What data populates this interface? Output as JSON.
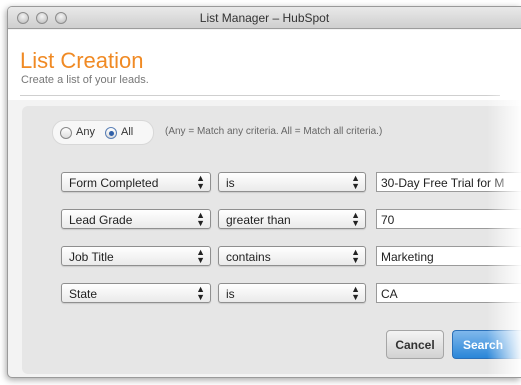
{
  "window": {
    "title": "List Manager – HubSpot"
  },
  "page": {
    "title": "List Creation",
    "subtitle": "Create a list of your leads."
  },
  "match": {
    "any_label": "Any",
    "all_label": "All",
    "selected": "All",
    "help": "(Any = Match any criteria. All = Match all criteria.)"
  },
  "criteria": [
    {
      "field": "Form Completed",
      "operator": "is",
      "value": "30-Day Free Trial for M"
    },
    {
      "field": "Lead Grade",
      "operator": "greater than",
      "value": "70"
    },
    {
      "field": "Job Title",
      "operator": "contains",
      "value": "Marketing"
    },
    {
      "field": "State",
      "operator": "is",
      "value": "CA"
    }
  ],
  "buttons": {
    "cancel": "Cancel",
    "search": "Search"
  },
  "colors": {
    "title_accent": "#f08a24",
    "primary_button": "#2a86d8"
  }
}
